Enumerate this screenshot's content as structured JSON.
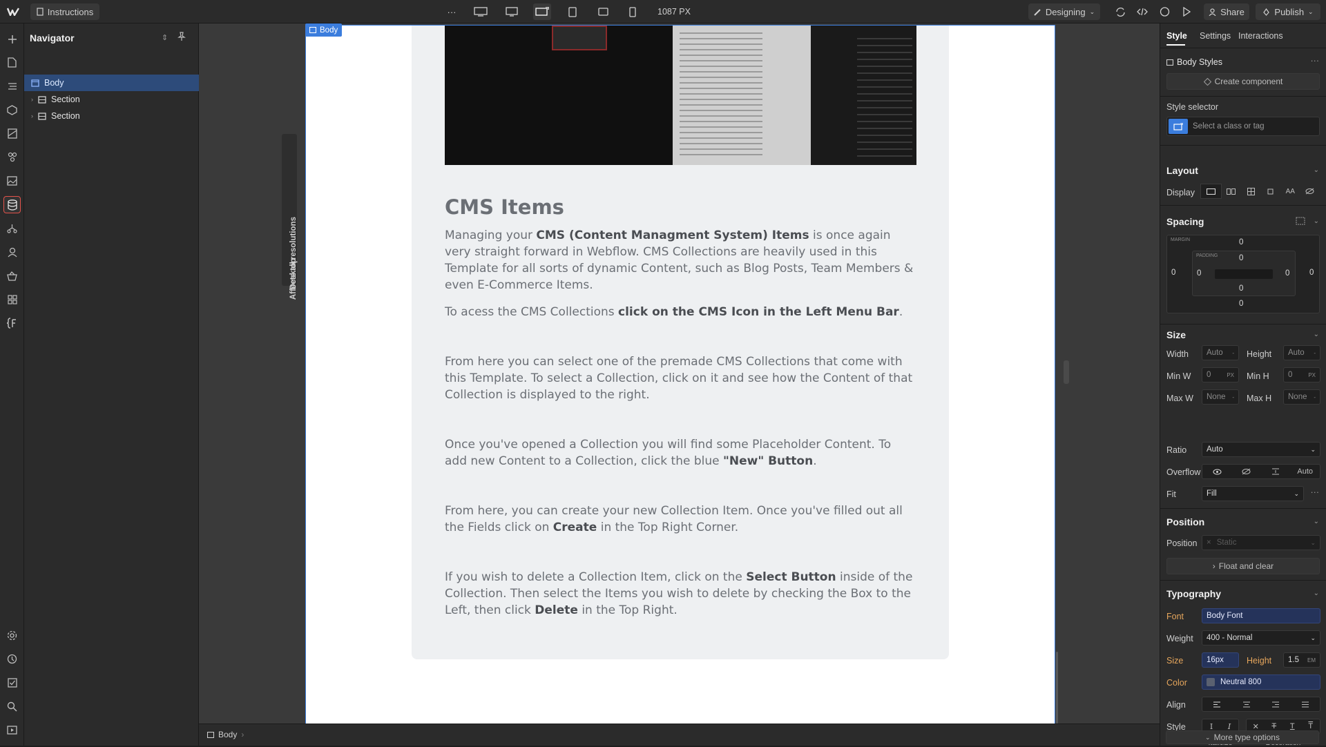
{
  "topbar": {
    "page_tab": "Instructions",
    "more": "···",
    "width_readout": "1087 PX",
    "mode": "Designing",
    "share": "Share",
    "publish": "Publish"
  },
  "navigator": {
    "title": "Navigator",
    "items": [
      {
        "label": "Body"
      },
      {
        "label": "Section"
      },
      {
        "label": "Section"
      }
    ]
  },
  "canvas": {
    "body_tag": "Body",
    "side_labels": {
      "affects": "Affects all resolutions",
      "desktop": "Desktop"
    },
    "heading": "CMS Items",
    "p1": {
      "pre": "Managing your ",
      "bold": "CMS (Content Managment System) Items",
      "post": " is once again very straight forward in Webflow. CMS Collections are heavily used in this Template for all sorts of dynamic Content, such as Blog Posts, Team Members & even E-Commerce Items."
    },
    "p2": {
      "pre": "To acess the CMS Collections ",
      "bold": "click on the CMS Icon in the Left Menu Bar",
      "post": "."
    },
    "p3": "From here you can select one of the premade CMS Collections that come with this Template. To select a Collection, click on it and see how the Content of that Collection is displayed to the right.",
    "p4": {
      "pre": "Once you've opened a Collection you will find some Placeholder Content. To add new Content to a Collection, click the blue ",
      "bold": "\"New\" Button",
      "post": "."
    },
    "p5": {
      "pre": "From here, you can create your new Collection Item. Once you've filled out all the Fields click on ",
      "bold": "Create",
      "post": " in the Top Right Corner."
    },
    "p6": {
      "pre": "If you wish to delete a Collection Item, click on the ",
      "bold1": "Select Button",
      "mid": " inside of the Collection. Then select the Items you wish to delete by checking the Box to the Left, then click ",
      "bold2": "Delete",
      "post": " in the Top Right."
    }
  },
  "bottombar": {
    "breadcrumb": "Body"
  },
  "rightpanel": {
    "tabs": [
      "Style",
      "Settings",
      "Interactions"
    ],
    "body_styles": "Body Styles",
    "create_component": "Create component",
    "style_selector": "Style selector",
    "selector_placeholder": "Select a class or tag",
    "layout": "Layout",
    "display": "Display",
    "spacing": "Spacing",
    "margin_label": "MARGIN",
    "padding_label": "PADDING",
    "zero": "0",
    "size": "Size",
    "width": "Width",
    "height": "Height",
    "minw": "Min W",
    "minh": "Min H",
    "maxw": "Max W",
    "maxh": "Max H",
    "auto": "Auto",
    "none": "None",
    "px": "PX",
    "ratio": "Ratio",
    "ratio_value": "Auto",
    "overflow": "Overflow",
    "overflow_auto": "Auto",
    "fit": "Fit",
    "fit_value": "Fill",
    "position": "Position",
    "position_value": "Static",
    "float_clear": "Float and clear",
    "typography": "Typography",
    "font": "Font",
    "font_value": "Body Font",
    "weight": "Weight",
    "weight_value": "400 - Normal",
    "size_lbl": "Size",
    "size_value": "16px",
    "height_lbl": "Height",
    "height_value": "1.5",
    "em": "EM",
    "color": "Color",
    "color_value": "Neutral 800",
    "align": "Align",
    "style": "Style",
    "italicize": "Italicize",
    "decoration": "Decoration",
    "more_type": "More type options"
  },
  "colors": {
    "accent": "#3b7ddd",
    "active_outline": "#e5534b",
    "swatch": "#5a6170"
  }
}
